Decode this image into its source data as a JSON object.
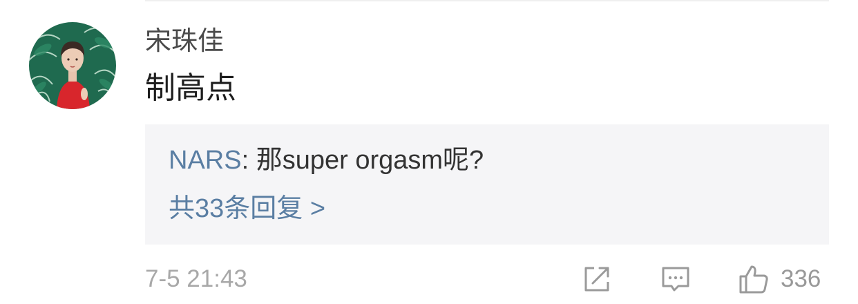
{
  "comment": {
    "username": "宋珠佳",
    "text": "制高点",
    "timestamp": "7-5 21:43",
    "like_count": "336"
  },
  "reply_preview": {
    "author": "NARS",
    "separator": ": ",
    "text": "那super orgasm呢?",
    "view_all_label": "共33条回复 >"
  },
  "icons": {
    "share": "share-icon",
    "reply": "comment-icon",
    "like": "thumbs-up-icon"
  },
  "colors": {
    "link": "#5a7ea3",
    "reply_background": "#f5f5f7",
    "meta_text": "#a8a8a8"
  }
}
